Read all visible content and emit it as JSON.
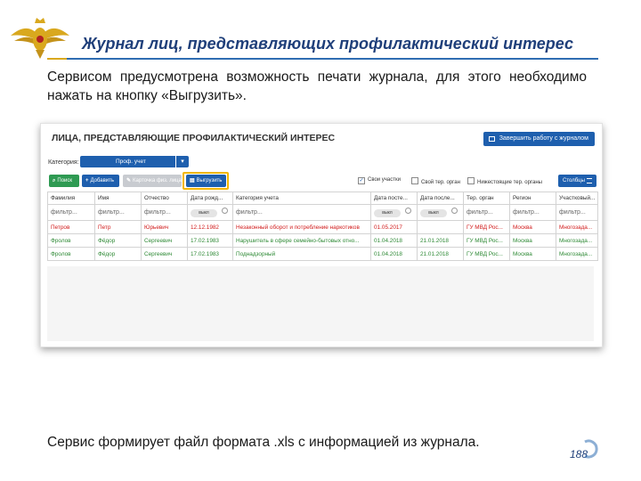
{
  "slide": {
    "title": "Журнал лиц, представляющих профилактический интерес",
    "intro": "Сервисом предусмотрена возможность печати журнала, для этого необходимо нажать на кнопку «Выгрузить».",
    "bottom_text": "Сервис формирует файл формата .xls с информацией из журнала.",
    "page_number": "188",
    "colors": {
      "title": "#1f3f7a",
      "rule": "#2f6db2",
      "accent_gold": "#d9a81e"
    }
  },
  "app": {
    "title": "ЛИЦА, ПРЕДСТАВЛЯЮЩИЕ ПРОФИЛАКТИЧЕСКИЙ ИНТЕРЕС",
    "finish_button": "Завершить работу с журналом",
    "category_label": "Категория:",
    "category_value": "Проф. учет",
    "toolbar": {
      "search": "Поиск",
      "add": "Добавить",
      "card": "Карточка физ. лица",
      "export": "Выгрузить"
    },
    "checkboxes": [
      {
        "label": "Свои участки",
        "checked": true
      },
      {
        "label": "Свой тер. орган",
        "checked": false
      },
      {
        "label": "Нижестоящие тер. органы",
        "checked": false
      }
    ],
    "columns_button": "Столбцы",
    "columns": [
      "Фамилия",
      "Имя",
      "Отчество",
      "Дата рожд...",
      "Категория учета",
      "Дата посте...",
      "Дата после...",
      "Тер. орган",
      "Регион",
      "Участковый..."
    ],
    "filters": [
      "фильтр...",
      "фильтр...",
      "фильтр...",
      "выкл",
      "фильтр...",
      "выкл",
      "выкл",
      "фильтр...",
      "фильтр...",
      "фильтр..."
    ],
    "rows": [
      {
        "status": "red",
        "cells": [
          "Петров",
          "Петр",
          "Юрьевич",
          "12.12.1982",
          "Незаконный оборот и потребление наркотиков",
          "01.05.2017",
          "",
          "ГУ МВД Рос...",
          "Москва",
          "Многозада..."
        ]
      },
      {
        "status": "green",
        "cells": [
          "Фролов",
          "Фёдор",
          "Сергеевич",
          "17.02.1983",
          "Нарушитель в сфере семейно-бытовых отно...",
          "01.04.2018",
          "21.01.2018",
          "ГУ МВД Рос...",
          "Москва",
          "Многозада..."
        ]
      },
      {
        "status": "green",
        "cells": [
          "Фролов",
          "Фёдор",
          "Сергеевич",
          "17.02.1983",
          "Поднадзорный",
          "01.04.2018",
          "21.01.2018",
          "ГУ МВД Рос...",
          "Москва",
          "Многозада..."
        ]
      }
    ],
    "colors": {
      "primary": "#1e5fae",
      "search": "#2e9a52",
      "highlight": "#f2b600",
      "row_red": "#d11b1b",
      "row_green": "#2f8a36"
    }
  }
}
